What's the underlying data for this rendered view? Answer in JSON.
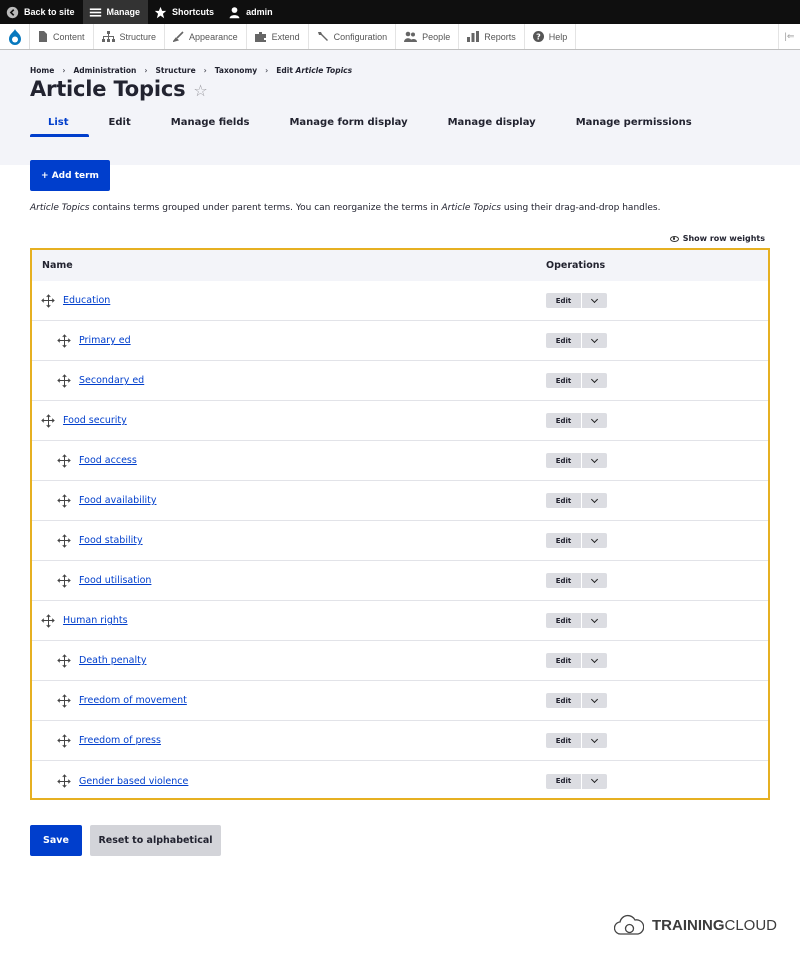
{
  "toolbar": {
    "back_to_site": "Back to site",
    "manage": "Manage",
    "shortcuts": "Shortcuts",
    "user": "admin"
  },
  "tray": {
    "items": [
      "Content",
      "Structure",
      "Appearance",
      "Extend",
      "Configuration",
      "People",
      "Reports",
      "Help"
    ]
  },
  "breadcrumb": [
    "Home",
    "Administration",
    "Structure",
    "Taxonomy",
    "Edit",
    "Article Topics"
  ],
  "page_title": "Article Topics",
  "tabs": [
    "List",
    "Edit",
    "Manage fields",
    "Manage form display",
    "Manage display",
    "Manage permissions"
  ],
  "add_term_label": "+ Add term",
  "description": {
    "vocab": "Article Topics",
    "part1": " contains terms grouped under parent terms. You can reorganize the terms in ",
    "part2": " using their drag-and-drop handles."
  },
  "show_row_weights": "Show row weights",
  "table": {
    "header_name": "Name",
    "header_operations": "Operations",
    "edit_label": "Edit",
    "rows": [
      {
        "name": "Education",
        "depth": 0
      },
      {
        "name": "Primary ed",
        "depth": 1
      },
      {
        "name": "Secondary ed",
        "depth": 1
      },
      {
        "name": "Food security",
        "depth": 0
      },
      {
        "name": "Food access",
        "depth": 1
      },
      {
        "name": "Food availability",
        "depth": 1
      },
      {
        "name": "Food stability",
        "depth": 1
      },
      {
        "name": "Food utilisation",
        "depth": 1
      },
      {
        "name": "Human rights",
        "depth": 0
      },
      {
        "name": "Death penalty",
        "depth": 1
      },
      {
        "name": "Freedom of movement",
        "depth": 1
      },
      {
        "name": "Freedom of press",
        "depth": 1
      },
      {
        "name": "Gender based violence",
        "depth": 1
      }
    ]
  },
  "save_label": "Save",
  "reset_label": "Reset to alphabetical",
  "brand": {
    "bold": "TRAINING",
    "rest": "CLOUD"
  },
  "colors": {
    "primary": "#003ecc",
    "highlight_border": "#e6b021",
    "header_bg": "#f3f4f9"
  }
}
